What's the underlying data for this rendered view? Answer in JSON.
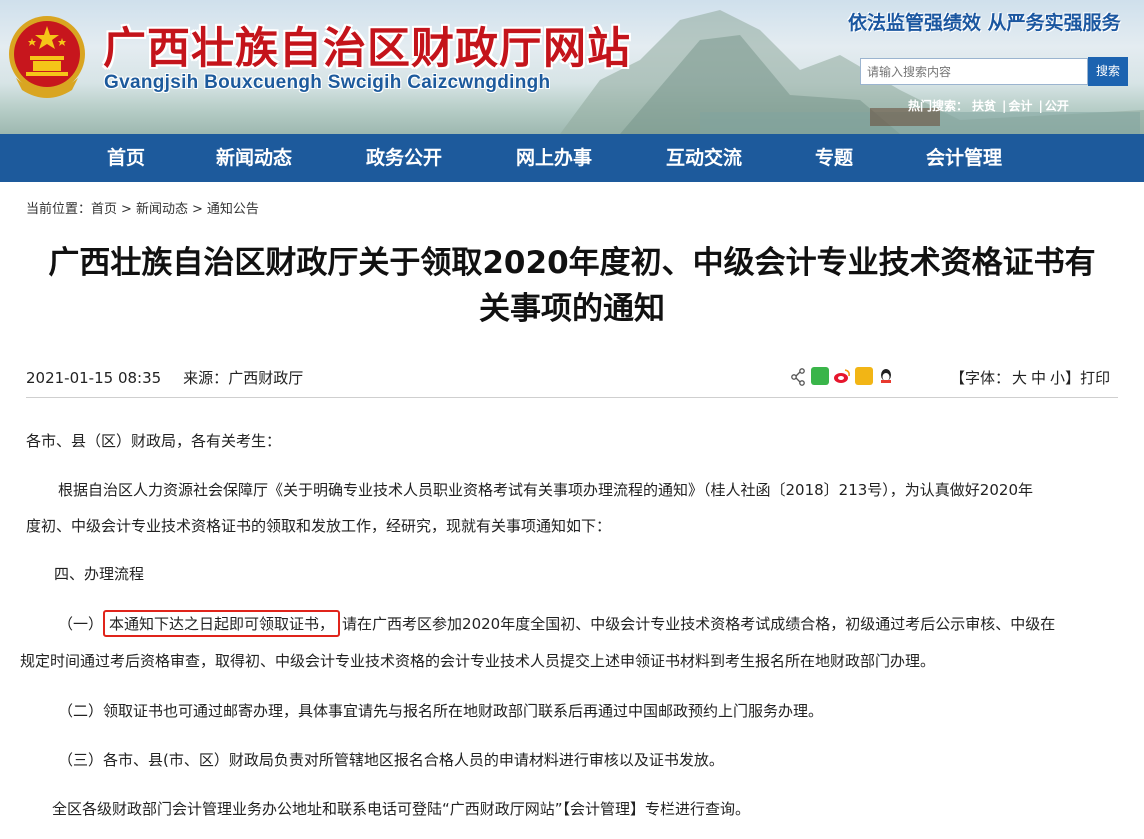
{
  "header": {
    "site_title": "广西壮族自治区财政厅网站",
    "site_subtitle": "Gvangjsih Bouxcuengh Swcigih Caizcwngdingh",
    "slogan": "依法监管强绩效 从严务实强服务",
    "search": {
      "placeholder": "请输入搜索内容",
      "button": "搜索"
    },
    "hot_search": {
      "label": "热门搜索：",
      "items": [
        "扶贫",
        "会计",
        "公开"
      ]
    }
  },
  "nav": {
    "items": [
      {
        "label": "首页"
      },
      {
        "label": "新闻动态"
      },
      {
        "label": "政务公开"
      },
      {
        "label": "网上办事"
      },
      {
        "label": "互动交流"
      },
      {
        "label": "专题"
      },
      {
        "label": "会计管理"
      }
    ]
  },
  "breadcrumb": {
    "label": "当前位置：",
    "items": [
      "首页",
      "新闻动态",
      "通知公告"
    ],
    "separator": ">"
  },
  "article": {
    "title_line1": "广西壮族自治区财政厅关于领取2020年度初、中级会计专业技术资格证书有",
    "title_line2": "关事项的通知",
    "date": "2021-01-15 08:35",
    "source_label": "来源：",
    "source": "广西财政厅",
    "font_label": "【字体：",
    "font_sizes": [
      "大",
      "中",
      "小"
    ],
    "font_close": "】",
    "print": "打印",
    "paragraphs": {
      "greeting": "各市、县（区）财政局，各有关考生：",
      "intro_1": "根据自治区人力资源社会保障厅《关于明确专业技术人员职业资格考试有关事项办理流程的通知》（桂人社函〔2018〕213号），为认真做好2020年",
      "intro_2": "度初、中级会计专业技术资格证书的领取和发放工作，经研究，现就有关事项通知如下：",
      "section_4": "四、办理流程",
      "item1_prefix": "（一）",
      "item1_highlight": "本通知下达之日起即可领取证书，",
      "item1_rest": "请在广西考区参加2020年度全国初、中级会计专业技术资格考试成绩合格，初级通过考后公示审核、中级在",
      "item1_line2": "规定时间通过考后资格审查，取得初、中级会计专业技术资格的会计专业技术人员提交上述申领证书材料到考生报名所在地财政部门办理。",
      "item2": "（二）领取证书也可通过邮寄办理，具体事宜请先与报名所在地财政部门联系后再通过中国邮政预约上门服务办理。",
      "item3": "（三）各市、县(市、区）财政局负责对所管辖地区报名合格人员的申请材料进行审核以及证书发放。",
      "closing": "全区各级财政部门会计管理业务办公地址和联系电话可登陆“广西财政厅网站”【会计管理】专栏进行查询。"
    }
  },
  "colors": {
    "title_red": "#c4141b",
    "nav_blue": "#1d5a9c",
    "highlight_border": "#e0241b"
  }
}
